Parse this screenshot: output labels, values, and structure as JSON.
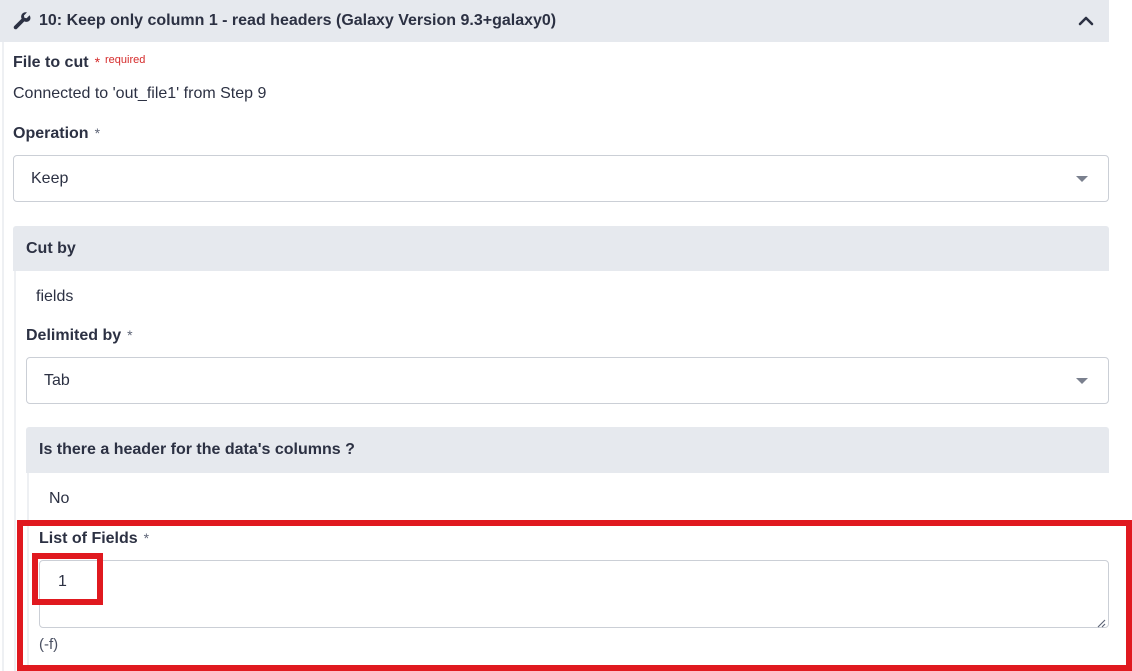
{
  "header": {
    "title": "10: Keep only column 1 - read headers (Galaxy Version 9.3+galaxy0)"
  },
  "file_to_cut": {
    "label": "File to cut",
    "required_star": "*",
    "required_text": "required",
    "value": "Connected to 'out_file1' from Step 9"
  },
  "operation": {
    "label": "Operation",
    "star": "*",
    "selected": "Keep"
  },
  "cut_by": {
    "title": "Cut by",
    "value": "fields"
  },
  "delimited_by": {
    "label": "Delimited by",
    "star": "*",
    "selected": "Tab"
  },
  "header_question": {
    "title": "Is there a header for the data's columns ?",
    "value": "No"
  },
  "list_of_fields": {
    "label": "List of Fields",
    "star": "*",
    "value": "1",
    "help": "(-f)"
  },
  "colors": {
    "highlight": "#e0191f",
    "panel_bg": "#e6e9ee",
    "required": "#d52b2b"
  },
  "icons": [
    "wrench-icon",
    "chevron-up-icon",
    "caret-down-icon",
    "resize-grip-icon"
  ]
}
